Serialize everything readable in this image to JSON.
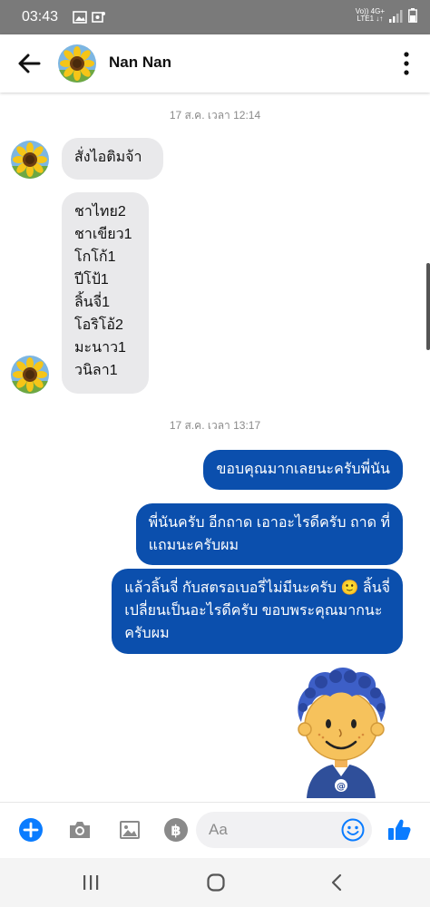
{
  "status_bar": {
    "time": "03:43",
    "network_top": "Vo)) 4G+",
    "network_bottom": "LTE1 ↓↑"
  },
  "header": {
    "contact_name": "Nan Nan",
    "avatar": "sunflower-photo"
  },
  "messages": [
    {
      "type": "timestamp",
      "text": "17 ส.ค. เวลา 12:14"
    },
    {
      "type": "incoming",
      "lines": [
        "สั่งไอติมจ้า"
      ]
    },
    {
      "type": "incoming",
      "lines": [
        "ชาไทย2",
        "ชาเขียว1",
        "โกโก้1",
        "ปีโป้1",
        "ลิ้นจี่1",
        "โอริโอ้2",
        "มะนาว1",
        "วนิลา1"
      ]
    },
    {
      "type": "timestamp",
      "text": "17 ส.ค. เวลา 13:17"
    },
    {
      "type": "outgoing",
      "lines": [
        "ขอบคุณมากเลยนะครับพี่นัน"
      ]
    },
    {
      "type": "outgoing",
      "lines": [
        "พี่นันครับ อีกถาด เอาอะไรดีครับ ถาด ที่",
        "แถมนะครับผม"
      ]
    },
    {
      "type": "outgoing",
      "lines": [
        "แล้วลิ้นจี่ กับสตรอเบอรี่ไม่มีนะครับ 🙂 ลิ้นจี่",
        "เปลี่ยนเป็นอะไรดีครับ ขอบพระคุณมากนะ",
        "ครับผม"
      ]
    },
    {
      "type": "sticker",
      "name": "curly-hair-boy-sticker"
    }
  ],
  "composer": {
    "placeholder": "Aa",
    "icons": [
      "plus-icon",
      "camera-icon",
      "image-icon",
      "baht-icon",
      "emoji-icon",
      "thumbs-up-icon"
    ]
  },
  "nav_bar": {
    "icons": [
      "recents-icon",
      "home-icon",
      "back-icon"
    ]
  },
  "colors": {
    "accent": "#0a7cff",
    "outgoing_bubble": "#0b4fad",
    "incoming_bubble": "#e9e9eb",
    "status_bar": "#7a7a7a"
  }
}
